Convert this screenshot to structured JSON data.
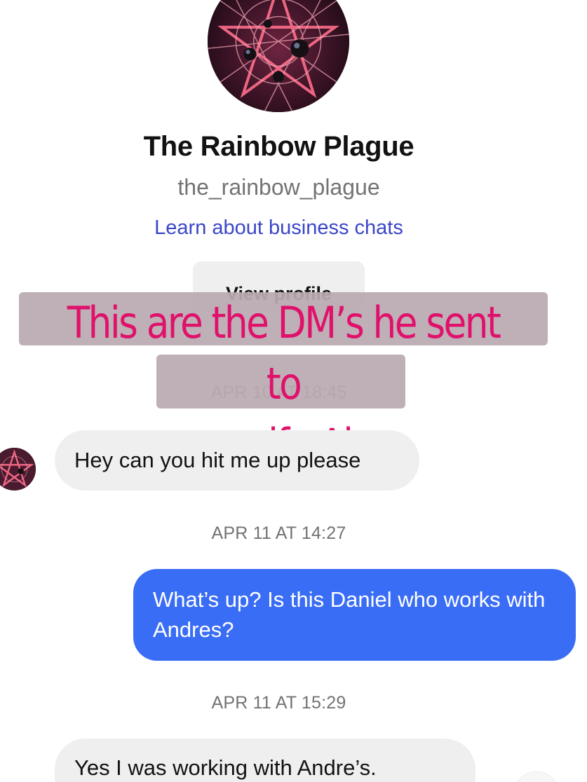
{
  "profile": {
    "name": "The Rainbow Plague",
    "handle": "the_rainbow_plague",
    "business_link": "Learn about business chats",
    "view_profile_label": "View profile",
    "avatar_icon": "pentagram-avatar"
  },
  "caption": {
    "text": "This are the DM’s he sent to\nmy wife Alex",
    "color": "#e0116b"
  },
  "messages": [
    {
      "type": "timestamp",
      "text": "APR 10 AT 18:45"
    },
    {
      "type": "incoming",
      "text": "Hey can you hit me up please"
    },
    {
      "type": "timestamp",
      "text": "APR 11 AT 14:27"
    },
    {
      "type": "outgoing",
      "text": "What’s up? Is this Daniel who works with Andres?"
    },
    {
      "type": "timestamp",
      "text": "APR 11 AT 15:29"
    },
    {
      "type": "incoming",
      "text": "Yes I was working with Andre’s."
    }
  ],
  "colors": {
    "outgoing_bubble": "#3a6df5",
    "incoming_bubble": "#efefef",
    "link": "#3a46c8"
  }
}
